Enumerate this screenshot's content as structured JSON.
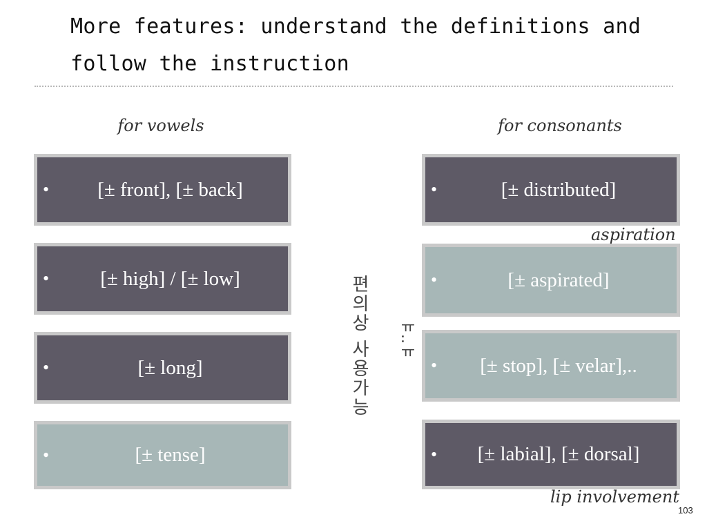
{
  "slide": {
    "title": "More features: understand the definitions and follow the instruction",
    "page_number": "103"
  },
  "vowels": {
    "heading": "for vowels",
    "items": [
      {
        "bullet": "•",
        "label": "[± front], [± back]",
        "style": "dark"
      },
      {
        "bullet": "•",
        "label": "[± high] / [± low]",
        "style": "dark"
      },
      {
        "bullet": "•",
        "label": "[± long]",
        "style": "dark"
      },
      {
        "bullet": "•",
        "label": "[± tense]",
        "style": "light"
      }
    ]
  },
  "consonants": {
    "heading": "for consonants",
    "items": [
      {
        "bullet": "•",
        "label": "[± distributed]",
        "style": "dark"
      },
      {
        "bullet": "•",
        "label": "[± aspirated]",
        "style": "light"
      },
      {
        "bullet": "•",
        "label": "[± stop], [± velar],..",
        "style": "light"
      },
      {
        "bullet": "•",
        "label": "[± labial], [± dorsal]",
        "style": "dark"
      }
    ],
    "annotations": {
      "aspiration": "aspiration",
      "lip_involvement": "lip involvement"
    }
  },
  "side_notes": {
    "korean": "편의상 사용가능",
    "emoticon": "ㅠ..ㅠ"
  },
  "colors": {
    "dark_box": "#5e5a66",
    "light_box": "#a7b7b7",
    "box_border": "#c9c9c9"
  }
}
